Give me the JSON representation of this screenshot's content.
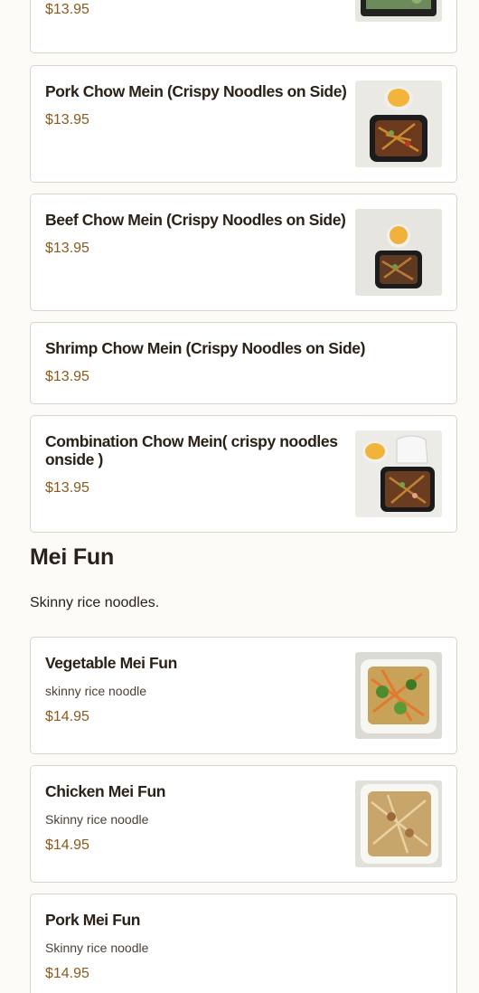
{
  "top_item": {
    "price": "$13.95"
  },
  "chow_mein_items": [
    {
      "name": "Pork Chow Mein (Crispy Noodles on Side)",
      "price": "$13.95"
    },
    {
      "name": "Beef Chow Mein (Crispy Noodles on Side)",
      "price": "$13.95"
    },
    {
      "name": "Shrimp Chow Mein (Crispy Noodles on Side)",
      "price": "$13.95"
    },
    {
      "name": "Combination Chow Mein( crispy noodles onside )",
      "price": "$13.95"
    }
  ],
  "mei_fun_section": {
    "title": "Mei Fun",
    "description": "Skinny rice noodles.",
    "items": [
      {
        "name": "Vegetable Mei Fun",
        "description": "skinny rice noodle",
        "price": "$14.95"
      },
      {
        "name": "Chicken Mei Fun",
        "description": "Skinny rice noodle",
        "price": "$14.95"
      },
      {
        "name": "Pork Mei Fun",
        "description": "Skinny rice noodle",
        "price": "$14.95"
      }
    ]
  },
  "colors": {
    "price": "#8a5a1c",
    "border": "#d9d3cb",
    "background": "#fcfbf8"
  }
}
